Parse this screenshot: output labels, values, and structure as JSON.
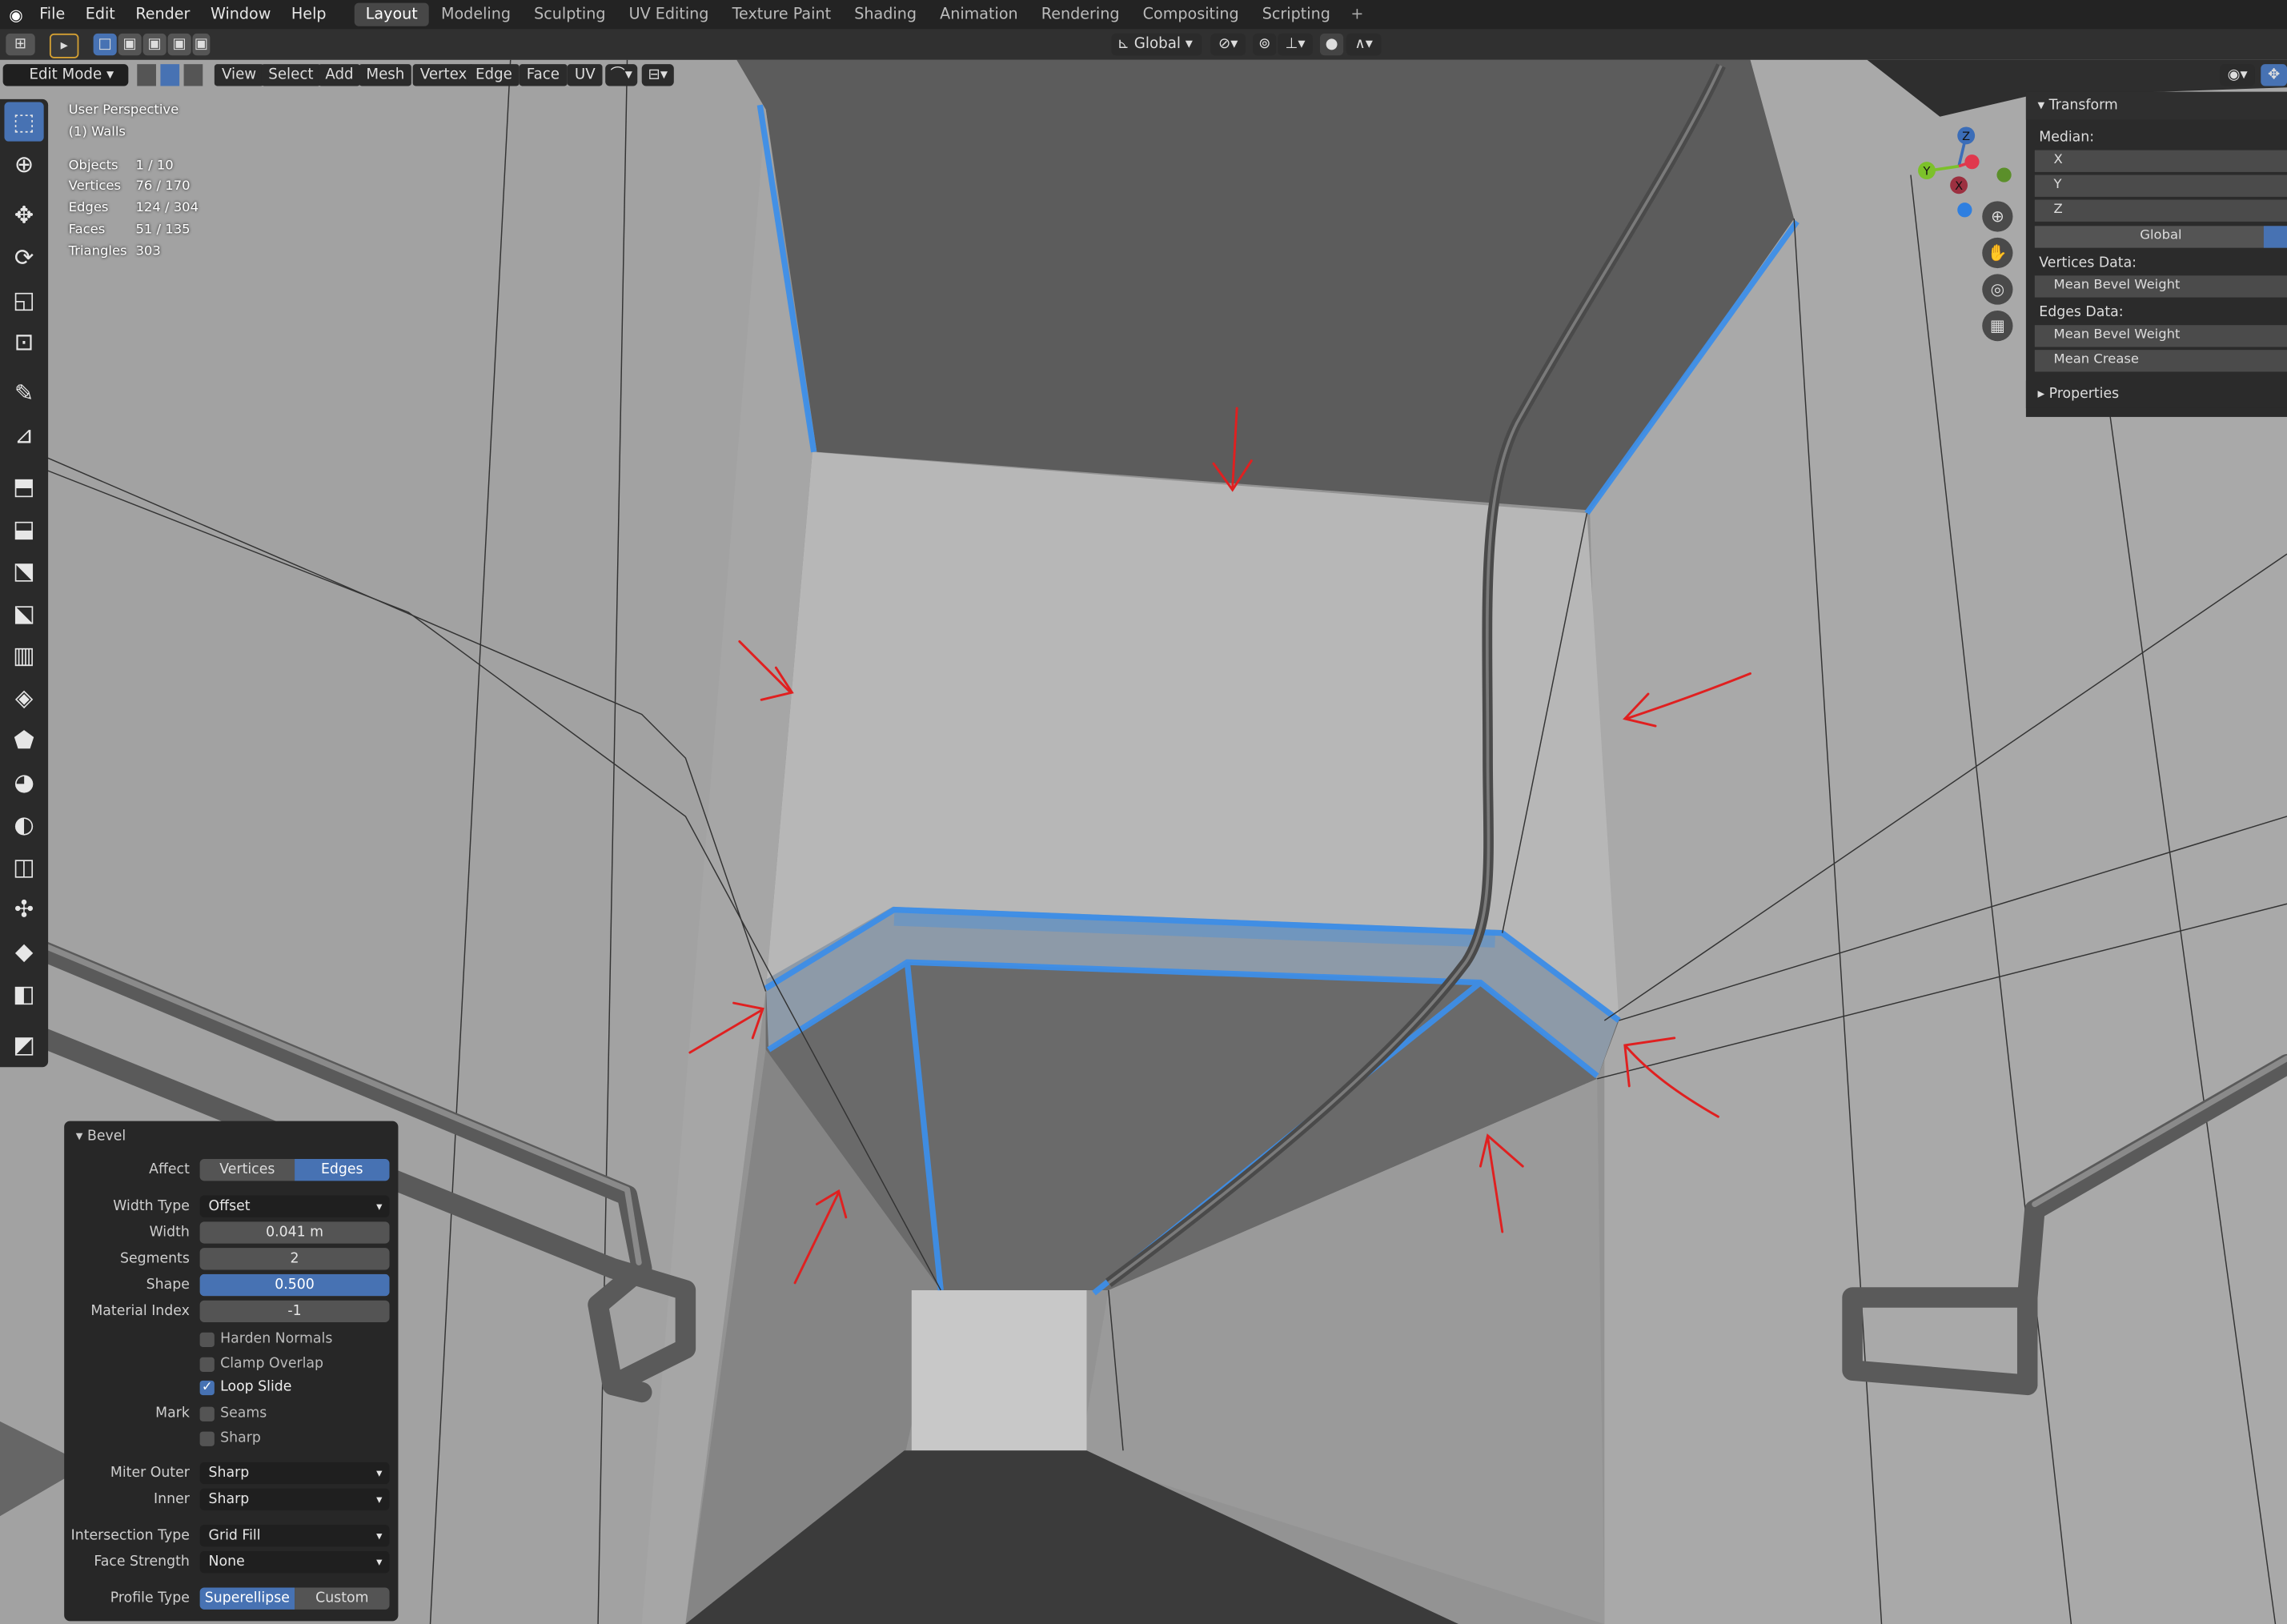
{
  "app": {
    "logo": "blender-logo"
  },
  "menu": [
    "File",
    "Edit",
    "Render",
    "Window",
    "Help"
  ],
  "workspaces": [
    {
      "label": "Layout",
      "active": true
    },
    {
      "label": "Modeling"
    },
    {
      "label": "Sculpting"
    },
    {
      "label": "UV Editing"
    },
    {
      "label": "Texture Paint"
    },
    {
      "label": "Shading"
    },
    {
      "label": "Animation"
    },
    {
      "label": "Rendering"
    },
    {
      "label": "Compositing"
    },
    {
      "label": "Scripting"
    }
  ],
  "add_workspace": "+",
  "transform_orientation": "Global",
  "header": {
    "mode": "Edit Mode",
    "menus": [
      "View",
      "Select",
      "Add",
      "Mesh",
      "Vertex",
      "Edge",
      "Face",
      "UV"
    ]
  },
  "overlay": {
    "view": "User Perspective",
    "object": "(1) Walls",
    "stats": [
      {
        "k": "Objects",
        "v": "1 / 10"
      },
      {
        "k": "Vertices",
        "v": "76 / 170"
      },
      {
        "k": "Edges",
        "v": "124 / 304"
      },
      {
        "k": "Faces",
        "v": "51 / 135"
      },
      {
        "k": "Triangles",
        "v": "303"
      }
    ]
  },
  "gizmo": {
    "z": "Z",
    "y": "Y",
    "x": "X"
  },
  "npanel": {
    "transform": "Transform",
    "median": "Median:",
    "x": "X",
    "y": "Y",
    "z": "Z",
    "space": "Global",
    "vertices_data": "Vertices Data:",
    "v_mean_bevel": "Mean Bevel Weight",
    "edges_data": "Edges Data:",
    "e_mean_bevel": "Mean Bevel Weight",
    "mean_crease": "Mean Crease",
    "properties": "Properties"
  },
  "bevel": {
    "title": "Bevel",
    "affect_label": "Affect",
    "affect_options": [
      "Vertices",
      "Edges"
    ],
    "affect_selected": "Edges",
    "width_type_label": "Width Type",
    "width_type": "Offset",
    "width_label": "Width",
    "width": "0.041 m",
    "segments_label": "Segments",
    "segments": "2",
    "shape_label": "Shape",
    "shape": "0.500",
    "shape_fraction": 0.5,
    "material_label": "Material Index",
    "material": "-1",
    "harden_normals": "Harden Normals",
    "clamp_overlap": "Clamp Overlap",
    "loop_slide": "Loop Slide",
    "loop_slide_checked": true,
    "mark_label": "Mark",
    "seams": "Seams",
    "sharp": "Sharp",
    "miter_outer_label": "Miter Outer",
    "miter_outer": "Sharp",
    "inner_label": "Inner",
    "inner": "Sharp",
    "intersection_label": "Intersection Type",
    "intersection": "Grid Fill",
    "face_strength_label": "Face Strength",
    "face_strength": "None",
    "profile_label": "Profile Type",
    "profile_options": [
      "Superellipse",
      "Custom"
    ],
    "profile_selected": "Superellipse"
  },
  "colors": {
    "accent": "#4772b3",
    "selection_edge": "#3d8ee8",
    "annotation": "#e02020"
  }
}
